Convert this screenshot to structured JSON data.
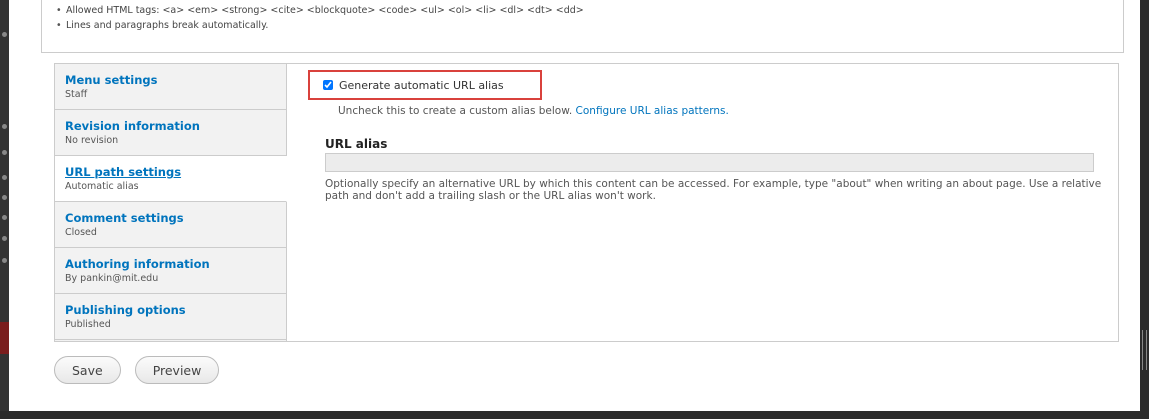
{
  "format_tips": [
    "Allowed HTML tags: <a> <em> <strong> <cite> <blockquote> <code> <ul> <ol> <li> <dl> <dt> <dd>",
    "Lines and paragraphs break automatically."
  ],
  "vertical_tabs": [
    {
      "title": "Menu settings",
      "summary": "Staff"
    },
    {
      "title": "Revision information",
      "summary": "No revision"
    },
    {
      "title": "URL path settings",
      "summary": "Automatic alias"
    },
    {
      "title": "Comment settings",
      "summary": "Closed"
    },
    {
      "title": "Authoring information",
      "summary": "By pankin@mit.edu"
    },
    {
      "title": "Publishing options",
      "summary": "Published"
    }
  ],
  "url_path": {
    "auto_alias_label": "Generate automatic URL alias",
    "auto_alias_checked": true,
    "auto_alias_desc": "Uncheck this to create a custom alias below.",
    "configure_link": "Configure URL alias patterns.",
    "alias_label": "URL alias",
    "alias_value": "",
    "alias_desc": "Optionally specify an alternative URL by which this content can be accessed. For example, type \"about\" when writing an about page. Use a relative path and don't add a trailing slash or the URL alias won't work."
  },
  "actions": {
    "save_label": "Save",
    "preview_label": "Preview"
  },
  "colors": {
    "link": "#0074bd",
    "highlight_border": "#d9413c",
    "tab_background": "#f2f2f2"
  }
}
